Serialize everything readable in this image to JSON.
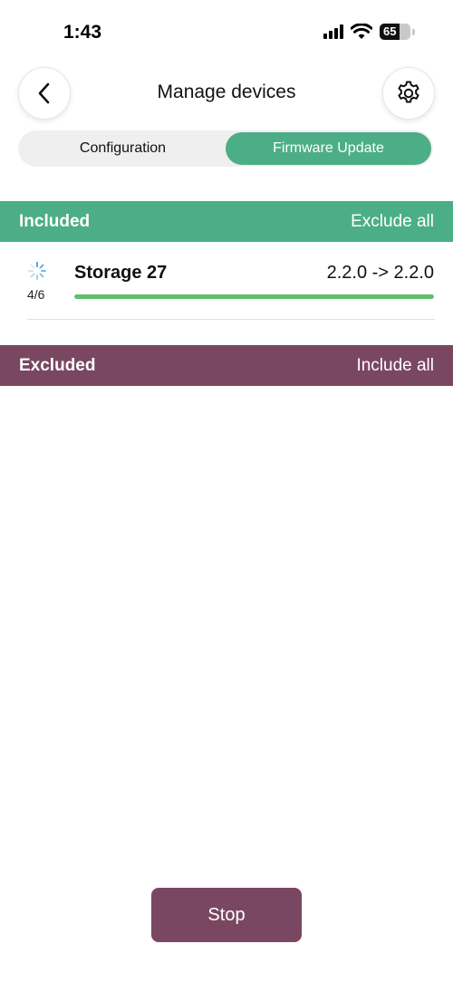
{
  "status_bar": {
    "time": "1:43",
    "battery_level": "65",
    "battery_fraction": 0.65,
    "icons": [
      "signal-icon",
      "wifi-icon",
      "battery-icon"
    ]
  },
  "header": {
    "title": "Manage devices",
    "back_icon": "chevron-left-icon",
    "settings_icon": "gear-icon"
  },
  "tabs": [
    {
      "label": "Configuration",
      "active": false
    },
    {
      "label": "Firmware Update",
      "active": true
    }
  ],
  "included": {
    "title": "Included",
    "action": "Exclude all",
    "devices": [
      {
        "name": "Storage 27",
        "version": "2.2.0 -> 2.2.0",
        "step_text": "4/6",
        "progress": 1.0
      }
    ]
  },
  "excluded": {
    "title": "Excluded",
    "action": "Include all",
    "devices": []
  },
  "footer": {
    "stop_label": "Stop"
  },
  "colors": {
    "accent_green": "#4cae86",
    "accent_plum": "#7a4762",
    "progress_green": "#5cbf6c"
  }
}
